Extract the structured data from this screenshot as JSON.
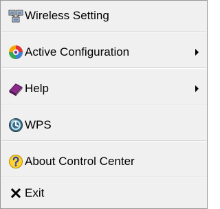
{
  "menu": {
    "items": [
      {
        "label": "Wireless Setting",
        "icon": "wireless-setting-icon",
        "has_submenu": false
      },
      {
        "label": "Active Configuration",
        "icon": "active-configuration-icon",
        "has_submenu": true
      },
      {
        "label": "Help",
        "icon": "help-book-icon",
        "has_submenu": true
      },
      {
        "label": "WPS",
        "icon": "wps-icon",
        "has_submenu": false
      },
      {
        "label": "About Control Center",
        "icon": "about-question-icon",
        "has_submenu": false
      },
      {
        "label": "Exit",
        "icon": "exit-x-icon",
        "has_submenu": false
      }
    ]
  },
  "colors": {
    "menu_background": "#f0f0f0",
    "menu_border": "#979797",
    "separator": "#d7d7d7"
  }
}
